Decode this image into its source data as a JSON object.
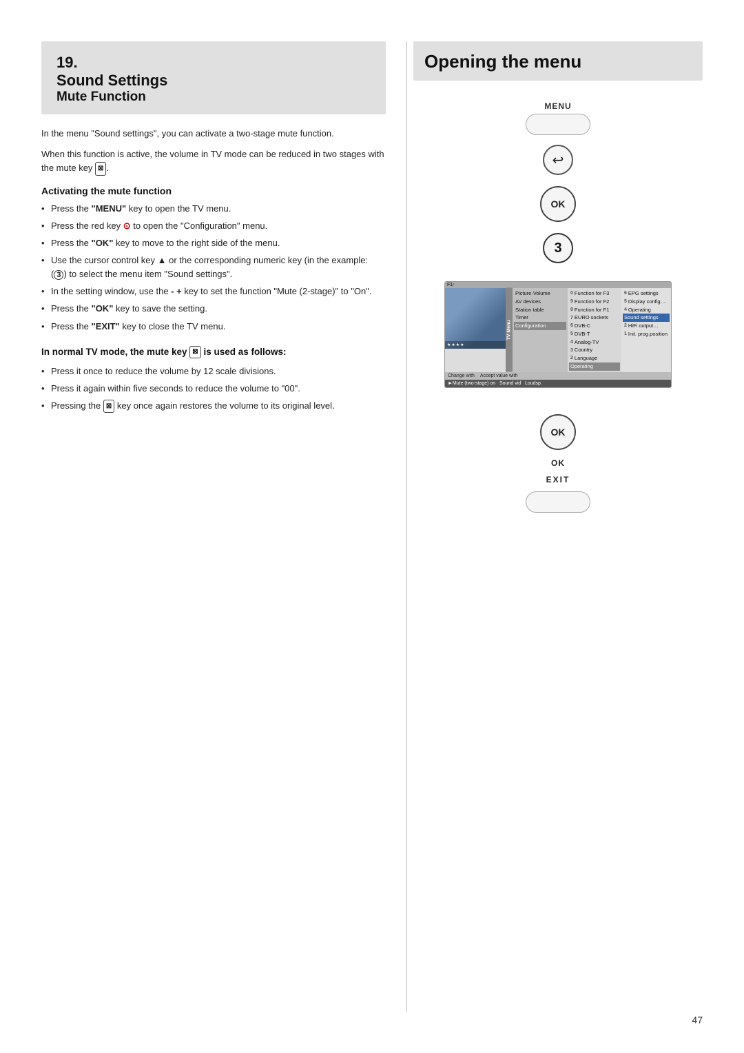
{
  "page": {
    "number": "47",
    "background": "#ffffff"
  },
  "left": {
    "section": {
      "number": "19.",
      "title": "Sound Settings",
      "subtitle": "Mute Function"
    },
    "intro": [
      "In the menu \"Sound settings\", you can activate a two-stage mute function.",
      "When this function is active, the volume in TV mode can be reduced in two stages with the mute key ."
    ],
    "activating_heading": "Activating the mute function",
    "activating_bullets": [
      {
        "text": "Press the ",
        "bold": "MENU",
        "rest": " key to open the TV menu."
      },
      {
        "text": "Press the red key  to open the \"Configuration\" menu."
      },
      {
        "text": "Press the ",
        "bold": "OK",
        "rest": " key to move to the right side of the menu."
      },
      {
        "text": "Use the cursor control key ▲ or the corresponding numeric key (in the example: ( ) to select the menu item \"Sound settings\"."
      },
      {
        "text": "In the setting window, use the - + key to set the function \"Mute (2-stage)\" to \"On\"."
      },
      {
        "text": "Press the ",
        "bold": "OK",
        "rest": " key to save the setting."
      },
      {
        "text": "Press the ",
        "bold": "EXIT",
        "rest": " key to close the TV menu."
      }
    ],
    "normal_mode_heading": "In normal TV mode, the mute key  is used as follows:",
    "normal_mode_bullets": [
      "Press it once to reduce the volume by 12 scale divisions.",
      "Press it again within five seconds to reduce the volume to \"00\".",
      "Pressing the  key once again restores the volume to its original level."
    ]
  },
  "right": {
    "opening_menu_title": "Opening the menu",
    "menu_label": "MENU",
    "steps": [
      {
        "type": "button_pill",
        "label": ""
      },
      {
        "type": "back_arrow",
        "label": "↩"
      },
      {
        "type": "ok_circle",
        "label": "OK"
      },
      {
        "type": "number_circle",
        "label": "3"
      }
    ],
    "ok_bottom_label": "OK",
    "exit_label": "EXIT",
    "tv_menu": {
      "header": "F1↑",
      "menu_label": "TV Menu",
      "col1_items": [
        {
          "label": "Picture·Volume",
          "highlighted": false
        },
        {
          "label": "AV devices",
          "highlighted": false
        },
        {
          "label": "Station table",
          "highlighted": false
        },
        {
          "label": "Timer",
          "highlighted": false
        },
        {
          "label": "Configuration",
          "highlighted": true
        }
      ],
      "col2_items": [
        {
          "num": "0",
          "label": "Function for F3",
          "highlighted": false
        },
        {
          "num": "9",
          "label": "Function for F2",
          "highlighted": false
        },
        {
          "num": "8",
          "label": "Function for F1",
          "highlighted": false
        },
        {
          "num": "7",
          "label": "EURO sockets",
          "highlighted": false
        },
        {
          "num": "6",
          "label": "DVB-C",
          "highlighted": false
        },
        {
          "num": "5",
          "label": "DVB-T",
          "highlighted": false
        },
        {
          "num": "4",
          "label": "Analog-TV",
          "highlighted": false
        },
        {
          "num": "3",
          "label": "Country",
          "highlighted": false
        },
        {
          "num": "2",
          "label": "Language",
          "highlighted": false
        },
        {
          "num": "",
          "label": "Operating",
          "highlighted": true
        }
      ],
      "col3_items": [
        {
          "num": "6",
          "label": "EPG settings",
          "highlighted": false
        },
        {
          "num": "5",
          "label": "Display configuration",
          "highlighted": false
        },
        {
          "num": "4",
          "label": "Operating",
          "highlighted": false
        },
        {
          "num": "",
          "label": "Sound settings",
          "highlighted": true
        },
        {
          "num": "2",
          "label": "HiFi output",
          "highlighted": false
        },
        {
          "num": "1",
          "label": "Init. prog.position",
          "highlighted": false
        }
      ],
      "bottom_bar": "►Mute (two-stage) on   Sound vid   Loudsp.",
      "change_with": "Change with",
      "accept_with": "Accept value with"
    }
  }
}
